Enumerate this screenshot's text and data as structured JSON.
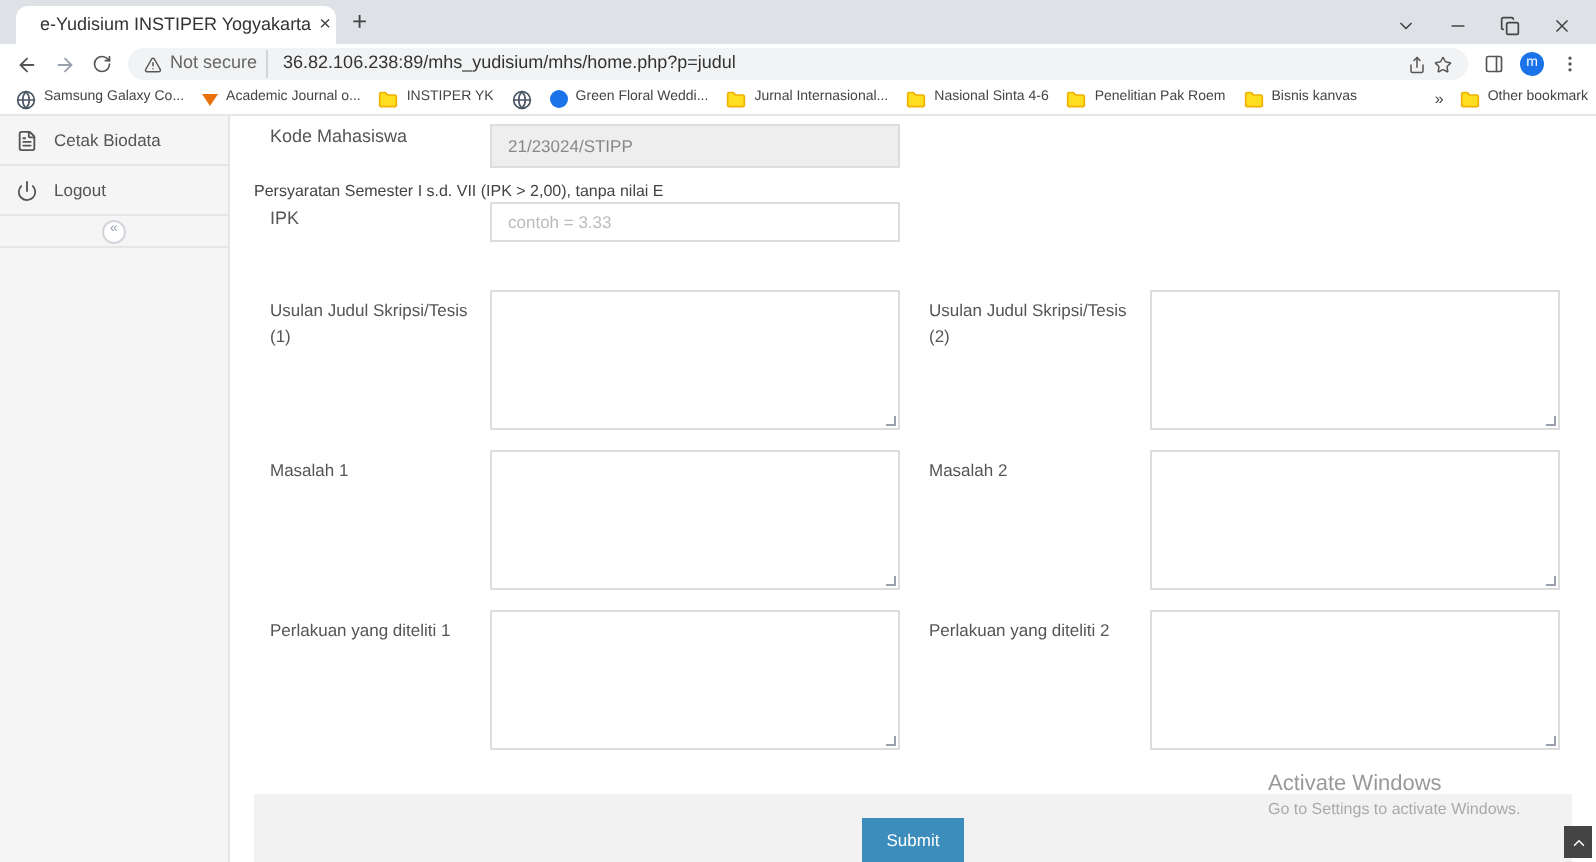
{
  "browser": {
    "tab_title": "e-Yudisium INSTIPER Yogyakarta",
    "tab_close": "×",
    "new_tab": "+",
    "security": "Not secure",
    "url": "36.82.106.238:89/mhs_yudisium/mhs/home.php?p=judul",
    "profile": "m",
    "bookmarks": [
      {
        "label": "Samsung Galaxy Co...",
        "kind": "globe"
      },
      {
        "label": "Academic Journal o...",
        "kind": "logo"
      },
      {
        "label": "INSTIPER YK",
        "kind": "folder"
      },
      {
        "kind": "globe"
      },
      {
        "label": "Green Floral Weddi...",
        "kind": "site"
      },
      {
        "label": "Jurnal Internasional...",
        "kind": "folder"
      },
      {
        "label": "Nasional Sinta 4-6",
        "kind": "folder"
      },
      {
        "label": "Penelitian Pak Roem",
        "kind": "folder"
      },
      {
        "label": "Bisnis kanvas",
        "kind": "folder"
      }
    ],
    "more": "»",
    "other_bookmarks": "Other bookmark"
  },
  "sidebar": {
    "items": [
      {
        "label": "Cetak Biodata",
        "kind": "document"
      },
      {
        "label": "Logout",
        "kind": "power"
      }
    ],
    "collapse": "«"
  },
  "form": {
    "student_code": {
      "label": "Kode Mahasiswa",
      "value": "21/23024/STIPP",
      "disabled": true
    },
    "requirement_note": "Persyaratan Semester I s.d. VII (IPK > 2,00), tanpa nilai E",
    "gpa": {
      "label": "IPK",
      "placeholder": "contoh = 3.33"
    },
    "rows": [
      [
        {
          "label": "Usulan Judul Skripsi/Tesis (1)"
        },
        {
          "label": "Usulan Judul Skripsi/Tesis (2)"
        }
      ],
      [
        {
          "label": "Masalah 1"
        },
        {
          "label": "Masalah 2"
        }
      ],
      [
        {
          "label": "Perlakuan yang diteliti 1"
        },
        {
          "label": "Perlakuan yang diteliti 2"
        }
      ]
    ],
    "submit": "Submit"
  },
  "os_notice": {
    "title": "Activate Windows",
    "text": "Go to Settings to activate Windows."
  }
}
